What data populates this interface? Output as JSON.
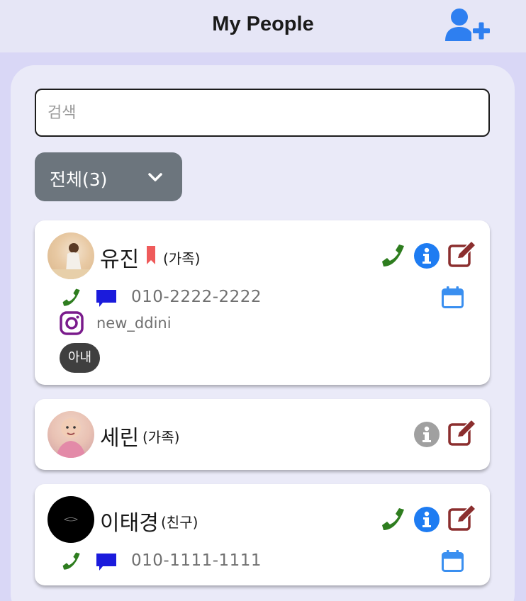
{
  "header": {
    "title": "My People",
    "add_icon": "user-plus-icon"
  },
  "search": {
    "placeholder": "검색",
    "value": ""
  },
  "filter": {
    "label": "전체(3)",
    "icon": "chevron-down-icon"
  },
  "colors": {
    "call": "#2e7d1f",
    "message": "#1b1bdc",
    "info": "#1e7cf2",
    "info_disabled": "#a0a0a0",
    "edit": "#8b2e2e",
    "calendar": "#3a8ff0",
    "instagram": "#7a1b8c",
    "bookmark": "#ef5b5b",
    "filter_bg": "#6c757d"
  },
  "contacts": [
    {
      "name": "유진",
      "relation": "(가족)",
      "bookmarked": true,
      "phone": "010-2222-2222",
      "instagram": "new_ddini",
      "tag": "아내"
    },
    {
      "name": "세린",
      "relation": "(가족)"
    },
    {
      "name": "이태경",
      "relation": "(친구)",
      "phone": "010-1111-1111"
    }
  ]
}
